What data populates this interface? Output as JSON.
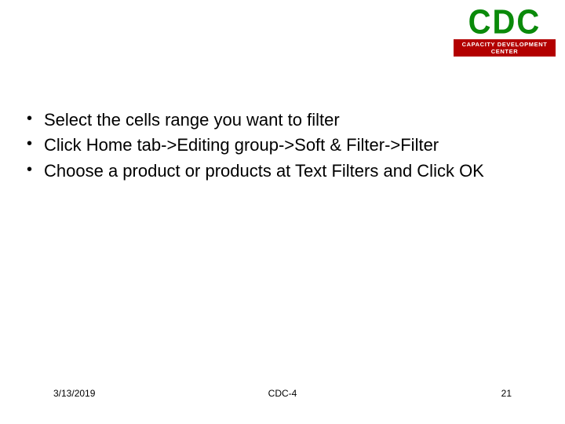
{
  "logo": {
    "main": "CDC",
    "subtitle": "CAPACITY DEVELOPMENT CENTER"
  },
  "bullets": [
    "Select the cells range you want to filter",
    "Click Home tab->Editing group->Soft & Filter->Filter",
    "Choose a product or products at Text Filters and Click OK"
  ],
  "footer": {
    "date": "3/13/2019",
    "center": "CDC-4",
    "page": "21"
  }
}
